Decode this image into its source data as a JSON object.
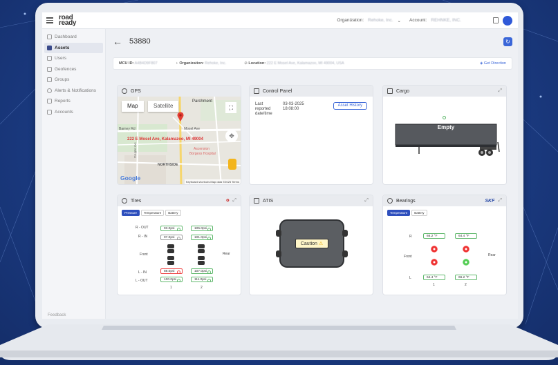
{
  "header": {
    "org_label": "Organization:",
    "org_value": "Rehoke, Inc.",
    "account_label": "Account:",
    "account_value": "REHNKE, INC."
  },
  "logo": {
    "line1": "road",
    "line2": "ready"
  },
  "sidebar": {
    "items": [
      {
        "label": "Dashboard"
      },
      {
        "label": "Assets"
      },
      {
        "label": "Users"
      },
      {
        "label": "Geofences"
      },
      {
        "label": "Groups"
      },
      {
        "label": "Alerts & Notifications"
      },
      {
        "label": "Reports"
      },
      {
        "label": "Accounts"
      }
    ],
    "feedback": "Feedback"
  },
  "page": {
    "title": "53880"
  },
  "info": {
    "mcu_label": "MCU ID:",
    "mcu_value": "A4B4D9F807",
    "org_label": "Organization:",
    "org_value": "Rehoke, Inc.",
    "loc_label": "Location:",
    "loc_value": "222 E Mosel Ave, Kalamazoo, MI 49004, USA",
    "direction": "Get Direction"
  },
  "gps": {
    "title": "GPS",
    "tab_map": "Map",
    "tab_sat": "Satellite",
    "address": "222 E Mosel Ave, Kalamazoo, MI 49004",
    "labels": [
      "Parchment",
      "Barney Rd",
      "Mosel Ave",
      "Ascension",
      "Borgess Hospital",
      "NORTHSIDE",
      "Douglas Ave"
    ],
    "google": "Google",
    "footer": "Keyboard shortcuts   Map data ©2025   Terms"
  },
  "control_panel": {
    "title": "Control Panel",
    "reported_label": "Last reported date/time",
    "date": "03-03-2025",
    "time": "18:08:00",
    "history_button": "Asset History"
  },
  "cargo": {
    "title": "Cargo",
    "status": "Empty"
  },
  "tires": {
    "title": "Tires",
    "tabs": [
      "Pressure",
      "Temperature",
      "Battery"
    ],
    "rows": [
      "R - OUT",
      "R - IN",
      "Front",
      "L - IN",
      "L - OUT"
    ],
    "rear": "Rear",
    "axle1": [
      "93.0psi",
      "97.0psi",
      "88.0psi",
      "100.0psi"
    ],
    "axle2": [
      "105.0psi",
      "101.0psi",
      "107.0psi",
      "111.0psi"
    ],
    "axles": [
      "1",
      "2"
    ]
  },
  "atis": {
    "title": "ATIS",
    "status": "Caution"
  },
  "bearings": {
    "title": "Bearings",
    "brand": "SKF",
    "tabs": [
      "Temperature",
      "Battery"
    ],
    "r_label": "R",
    "l_label": "L",
    "front": "Front",
    "rear": "Rear",
    "temps": [
      "66.2 °F",
      "64.4 °F",
      "64.4 °F",
      "66.2 °F"
    ],
    "axles": [
      "1",
      "2"
    ]
  }
}
